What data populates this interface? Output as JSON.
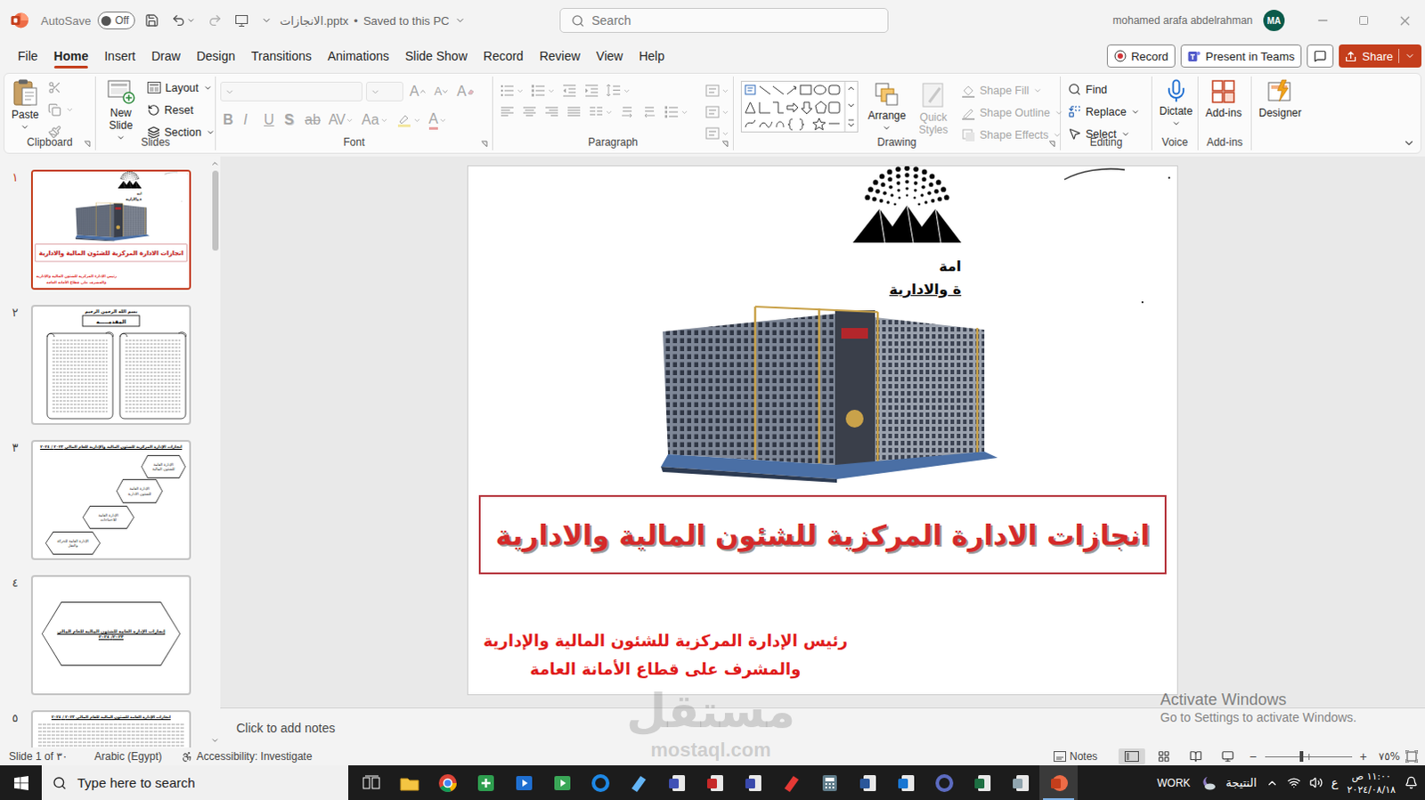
{
  "window": {
    "title": "الانجازات.pptx",
    "title_separator": "•",
    "save_state": "Saved to this PC",
    "autosave": {
      "label": "AutoSave",
      "state_label": "Off",
      "on": false
    },
    "search": {
      "placeholder": "Search"
    },
    "user": {
      "name": "mohamed arafa abdelrahman",
      "initials": "MA"
    }
  },
  "menu_tabs": [
    {
      "label": "File",
      "selected": false
    },
    {
      "label": "Home",
      "selected": true
    },
    {
      "label": "Insert",
      "selected": false
    },
    {
      "label": "Draw",
      "selected": false
    },
    {
      "label": "Design",
      "selected": false
    },
    {
      "label": "Transitions",
      "selected": false
    },
    {
      "label": "Animations",
      "selected": false
    },
    {
      "label": "Slide Show",
      "selected": false
    },
    {
      "label": "Record",
      "selected": false
    },
    {
      "label": "Review",
      "selected": false
    },
    {
      "label": "View",
      "selected": false
    },
    {
      "label": "Help",
      "selected": false
    }
  ],
  "menu_actions": {
    "record": "Record",
    "present": "Present in Teams",
    "share": "Share"
  },
  "ribbon": {
    "clipboard": {
      "label": "Clipboard",
      "paste": "Paste",
      "tools_disabled": true
    },
    "slides": {
      "label": "Slides",
      "new_slide": "New Slide",
      "commands": [
        {
          "label": "Layout",
          "dropdown": true
        },
        {
          "label": "Reset",
          "dropdown": false
        },
        {
          "label": "Section",
          "dropdown": true
        }
      ]
    },
    "font": {
      "label": "Font",
      "disabled": true,
      "font_name": "",
      "font_size": "",
      "size_buttons": [
        {
          "glyph": "A",
          "kind": "grow"
        },
        {
          "glyph": "A",
          "kind": "shrink"
        },
        {
          "glyph": "A",
          "kind": "clear"
        }
      ],
      "format_buttons": [
        {
          "glyph": "B",
          "kind": "bold"
        },
        {
          "glyph": "I",
          "kind": "italic"
        },
        {
          "glyph": "U",
          "kind": "underline"
        },
        {
          "glyph": "S",
          "kind": "shadow"
        },
        {
          "glyph": "ab",
          "kind": "strike"
        },
        {
          "glyph": "AV",
          "kind": "spacing"
        },
        {
          "glyph": "Aa",
          "kind": "case"
        },
        {
          "glyph": "",
          "kind": "highlight"
        },
        {
          "glyph": "A",
          "kind": "color"
        }
      ]
    },
    "paragraph": {
      "label": "Paragraph",
      "disabled": true
    },
    "drawing": {
      "label": "Drawing",
      "arrange": "Arrange",
      "quick_styles": {
        "label": "Quick Styles",
        "disabled": true
      },
      "shape_commands": [
        {
          "label": "Shape Fill",
          "disabled": true
        },
        {
          "label": "Shape Outline",
          "disabled": true
        },
        {
          "label": "Shape Effects",
          "disabled": true
        }
      ]
    },
    "editing": {
      "label": "Editing",
      "commands": [
        {
          "label": "Find",
          "dropdown": false
        },
        {
          "label": "Replace",
          "dropdown": true
        },
        {
          "label": "Select",
          "dropdown": true
        }
      ]
    },
    "voice": {
      "label": "Voice",
      "dictate": "Dictate"
    },
    "addins": {
      "label": "Add-ins",
      "button": "Add-ins"
    },
    "designer": {
      "button": "Designer"
    }
  },
  "thumbnails": [
    {
      "number": "١",
      "selected": true,
      "kind": "title"
    },
    {
      "number": "٢",
      "selected": false,
      "kind": "intro",
      "heading": "بسم الله الرحمن الرحيم",
      "box": "المقدمـــــة"
    },
    {
      "number": "٣",
      "selected": false,
      "kind": "chart",
      "heading": "انجازات الإدارة المركزية للشئون المالية والإدارية للعام المالي ٢٠٢٣ / ٢٠٢٤",
      "items": [
        "الإدارة العامة للشئون المالية",
        "الإدارة العامة للشئون الادارية",
        "الإدارة العامة للاحتياجات",
        "الإدارة العامة للحركة والنقل"
      ]
    },
    {
      "number": "٤",
      "selected": false,
      "kind": "hexagon",
      "heading": "إنجازات الإدارة العامة للشئون المالية للعام المالي ٢٠٢٣/ ٢٠٢٤"
    },
    {
      "number": "٥",
      "selected": false,
      "kind": "text",
      "heading": "انجازات الإدارة العامة للشئون المالية للعام المالي ٢٠٢٣ / ٢٠٢٤"
    }
  ],
  "slide": {
    "header_lines": [
      "امة",
      "ة والادارية"
    ],
    "title": "انجازات الادارة المركزية للشئون المالية والادارية",
    "subtitle": [
      "رئيس الإدارة المركزية للشئون المالية والإدارية",
      "والمشرف على قطاع الأمانة العامة"
    ]
  },
  "notes": {
    "placeholder": "Click to add notes"
  },
  "status_bar": {
    "slide_position": "Slide 1 of ٣٠",
    "language": "Arabic (Egypt)",
    "accessibility": "Accessibility: Investigate",
    "notes": "Notes",
    "views": [
      {
        "selected": true
      },
      {
        "selected": false
      },
      {
        "selected": false
      },
      {
        "selected": false
      }
    ],
    "zoom": {
      "minus": "−",
      "plus": "+",
      "level": 0.42,
      "reading": "٧٥%"
    }
  },
  "watermarks": {
    "activate": {
      "title": "Activate Windows",
      "hint": "Go to Settings to activate Windows."
    },
    "site": {
      "name": "مستقل",
      "url": "mostaql.com"
    }
  },
  "taskbar": {
    "search_placeholder": "Type here to search",
    "apps": [
      {
        "active": false
      },
      {
        "active": false
      },
      {
        "active": false
      },
      {
        "active": false
      },
      {
        "active": false
      },
      {
        "active": false
      },
      {
        "active": false
      },
      {
        "active": false
      },
      {
        "active": false
      },
      {
        "active": false
      },
      {
        "active": false
      },
      {
        "active": false
      },
      {
        "active": false
      },
      {
        "active": false
      },
      {
        "active": false
      },
      {
        "active": false
      },
      {
        "active": false
      },
      {
        "active": true
      }
    ],
    "work": "WORK",
    "weather": "النتيجة",
    "language": "ع",
    "time": "١١:٠٠ ص",
    "date": "٢٠٢٤/٠٨/١٨"
  }
}
